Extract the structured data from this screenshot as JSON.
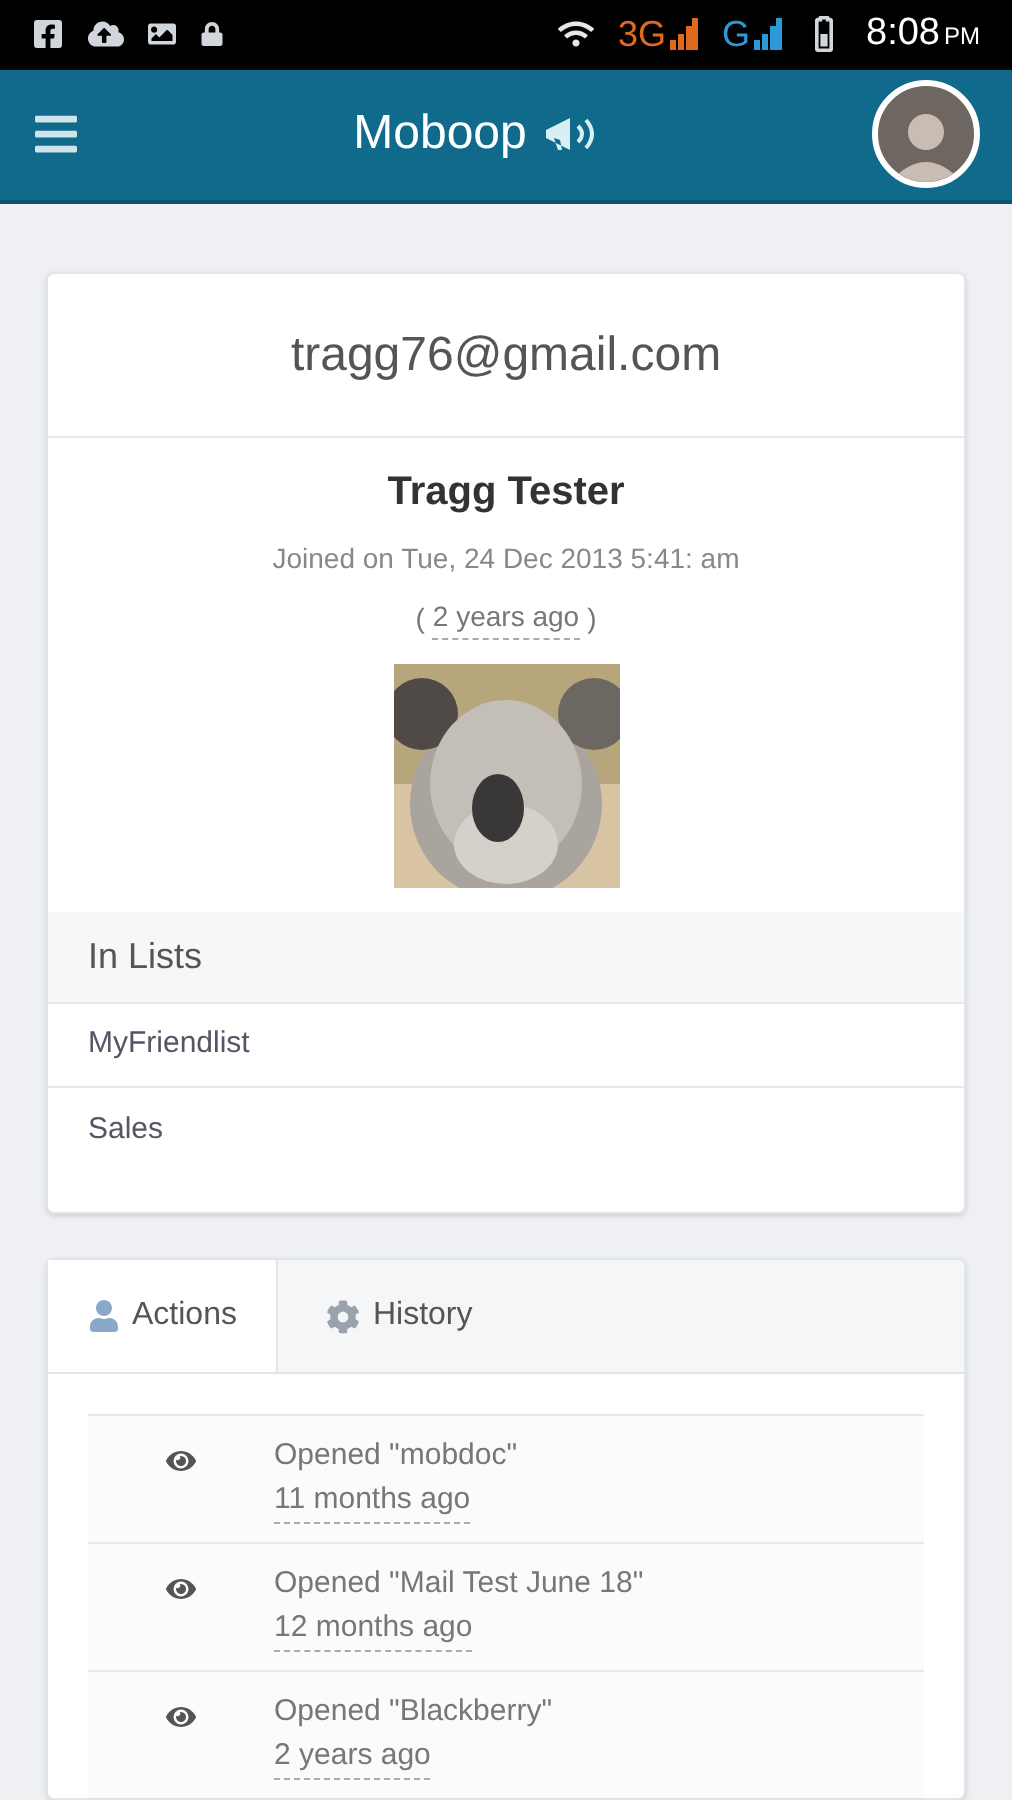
{
  "status_bar": {
    "network_1": "3G",
    "network_2": "G",
    "time": "8:08",
    "ampm": "PM"
  },
  "app_bar": {
    "title": "Moboop"
  },
  "profile": {
    "email": "tragg76@gmail.com",
    "name": "Tragg Tester",
    "joined": "Joined on Tue, 24 Dec 2013 5:41: am",
    "ago_open": "(",
    "ago": "2 years ago",
    "ago_close": ")"
  },
  "lists": {
    "heading": "In Lists",
    "items": [
      "MyFriendlist",
      "Sales"
    ]
  },
  "tabs": [
    {
      "label": "Actions",
      "kind": "user",
      "selected": true
    },
    {
      "label": "History",
      "kind": "gear",
      "selected": false
    }
  ],
  "actions": [
    {
      "text": "Opened \"mobdoc\"",
      "time": "11 months ago"
    },
    {
      "text": "Opened \"Mail Test June 18\"",
      "time": "12 months ago"
    },
    {
      "text": "Opened \"Blackberry\"",
      "time": "2 years ago"
    }
  ]
}
